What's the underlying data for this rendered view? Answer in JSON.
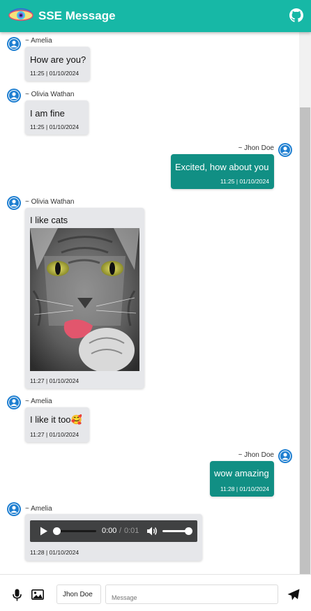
{
  "header": {
    "title": "SSE Message",
    "logo_icon": "eye-logo-icon",
    "repo_icon": "github-icon"
  },
  "colors": {
    "header": "#17b8a6",
    "outgoing_bubble": "#118f84",
    "incoming_bubble": "#e6e7ea",
    "avatar": "#1f7fd1"
  },
  "messages": [
    {
      "direction": "in",
      "sender": "~ Amelia",
      "text": "How are you?",
      "time": "11:25 | 01/10/2024"
    },
    {
      "direction": "in",
      "sender": "~ Olivia Wathan",
      "text": "I am fine",
      "time": "11:25 | 01/10/2024"
    },
    {
      "direction": "out",
      "sender": "~ Jhon Doe",
      "text": "Excited, how about you",
      "time": "11:25 | 01/10/2024"
    },
    {
      "direction": "in",
      "sender": "~ Olivia Wathan",
      "text": "I like cats",
      "attachment": "cat-photo",
      "time": "11:27 | 01/10/2024"
    },
    {
      "direction": "in",
      "sender": "~ Amelia",
      "text": "I like it too🥰",
      "time": "11:27 | 01/10/2024"
    },
    {
      "direction": "out",
      "sender": "~ Jhon Doe",
      "text": "wow amazing",
      "time": "11:28 | 01/10/2024"
    },
    {
      "direction": "in",
      "sender": "~ Amelia",
      "attachment": "audio",
      "audio": {
        "current": "0:00",
        "separator": " / ",
        "duration": "0:01",
        "progress": 0,
        "volume": 1.0
      },
      "time": "11:28 | 01/10/2024"
    }
  ],
  "composer": {
    "name_value": "Jhon Doe",
    "message_placeholder": "Message",
    "mic_icon": "microphone-icon",
    "image_icon": "image-icon",
    "send_icon": "send-icon"
  }
}
